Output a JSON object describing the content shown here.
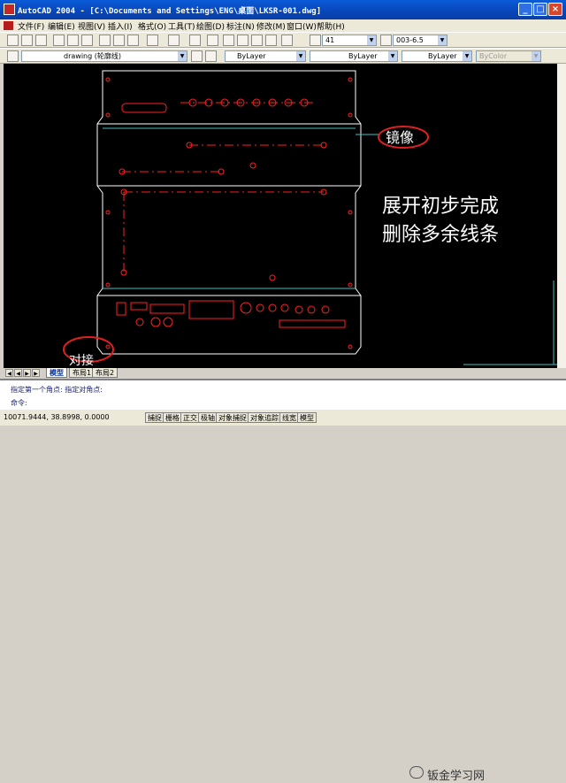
{
  "window": {
    "title": "AutoCAD 2004 - [C:\\Documents and Settings\\ENG\\桌面\\LKSR-001.dwg]",
    "buttons": {
      "minimize": "_",
      "maximize": "□",
      "close": "×"
    }
  },
  "menu": [
    "文件(F)",
    "编辑(E)",
    "视图(V)",
    "插入(I)",
    "格式(O)",
    "工具(T)",
    "绘图(D)",
    "标注(N)",
    "修改(M)",
    "窗口(W)",
    "帮助(H)"
  ],
  "toolbar": {
    "dimstyle_value": "41",
    "textstyle_value": "003-6.5"
  },
  "layers": {
    "current_layer": "drawing (轮廓线)",
    "color": "ByLayer",
    "linetype": "ByLayer",
    "lineweight": "ByLayer",
    "plotstyle": "ByColor"
  },
  "drawing": {
    "background": "#000000",
    "annotation_mirror": "镜像",
    "annotation_main_1": "展开初步完成",
    "annotation_main_2": "删除多余线条",
    "annotation_joint": "对接"
  },
  "layout_tabs": [
    "模型",
    "布局1",
    "布局2"
  ],
  "command": {
    "history": "指定第一个角点: 指定对角点:",
    "prompt": "命令:"
  },
  "status": {
    "coordinates": "10071.9444, 38.8998, 0.0000",
    "toggles": [
      "捕捉",
      "栅格",
      "正交",
      "极轴",
      "对象捕捉",
      "对象追踪",
      "线宽",
      "模型"
    ]
  },
  "watermark": "钣金学习网",
  "colors": {
    "outline": "#ffffff",
    "bend_lines": "#40c0c0",
    "holes": "#ff2020",
    "annotation_circles": "#e02020"
  }
}
